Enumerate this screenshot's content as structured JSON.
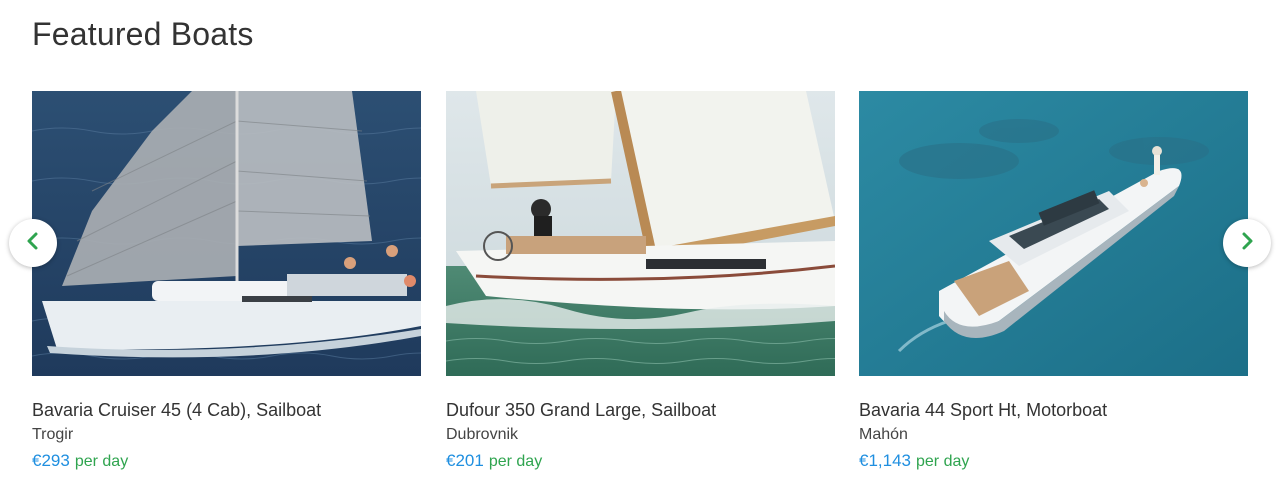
{
  "section": {
    "title": "Featured Boats"
  },
  "colors": {
    "price": "#1f8fe0",
    "per_day": "#2fa44f",
    "arrow": "#2fa44f"
  },
  "carousel": {
    "prev_icon": "chevron-left-icon",
    "next_icon": "chevron-right-icon"
  },
  "boats": [
    {
      "title": "Bavaria Cruiser 45 (4 Cab), Sailboat",
      "location": "Trogir",
      "price": "€293",
      "per_day": "per day"
    },
    {
      "title": "Dufour 350 Grand Large, Sailboat",
      "location": "Dubrovnik",
      "price": "€201",
      "per_day": "per day"
    },
    {
      "title": "Bavaria 44 Sport Ht, Motorboat",
      "location": "Mahón",
      "price": "€1,143",
      "per_day": "per day"
    }
  ]
}
